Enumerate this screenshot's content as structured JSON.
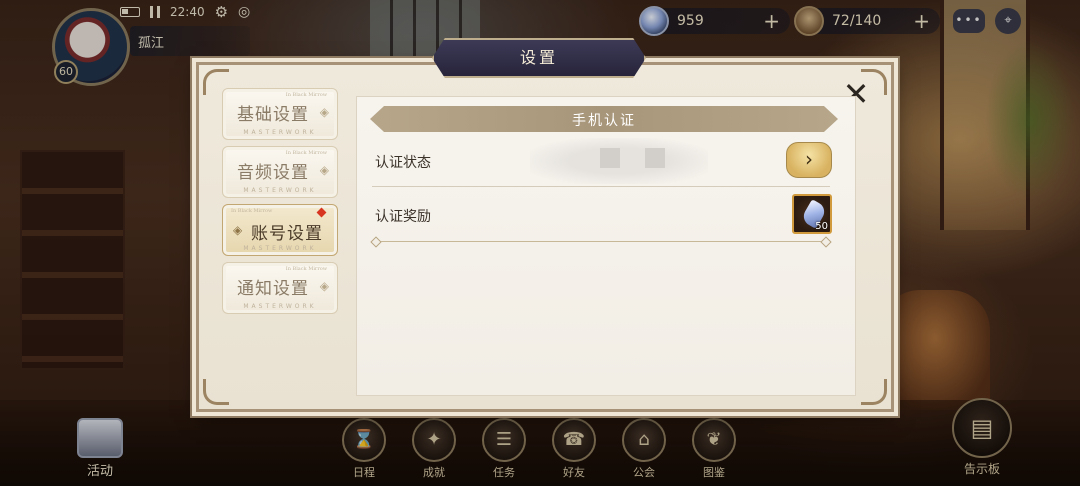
{
  "hud": {
    "time": "22:40",
    "player_name": "孤江",
    "level": "60",
    "gems": "959",
    "stamina": "72/140",
    "plus": "+",
    "chat_dots": "•••"
  },
  "modal": {
    "title": "设置",
    "close_glyph": "✕",
    "tabs": [
      {
        "label": "基础设置",
        "sub": "MASTERWORK",
        "script": "In Black Mirrow",
        "deco": "◈"
      },
      {
        "label": "音频设置",
        "sub": "MASTERWORK",
        "script": "In Black Mirrow",
        "deco": "◈"
      },
      {
        "label": "账号设置",
        "sub": "MASTERWORK",
        "script": "In Black Mirrow",
        "deco": "◈"
      },
      {
        "label": "通知设置",
        "sub": "MASTERWORK",
        "script": "In Black Mirrow",
        "deco": "◈"
      }
    ],
    "section_title": "手机认证",
    "rows": {
      "status_label": "认证状态",
      "reward_label": "认证奖励",
      "go_glyph": "›",
      "reward_count": "50"
    }
  },
  "bottom_nav": {
    "activity": "活动",
    "items": [
      {
        "label": "日程",
        "glyph": "⌛"
      },
      {
        "label": "成就",
        "glyph": "✦"
      },
      {
        "label": "任务",
        "glyph": "☰"
      },
      {
        "label": "好友",
        "glyph": "☎"
      },
      {
        "label": "公会",
        "glyph": "⌂"
      },
      {
        "label": "图鉴",
        "glyph": "❦"
      }
    ],
    "board": "告示板",
    "board_glyph": "▤"
  },
  "colors": {
    "accent_gold": "#d8b260",
    "panel_bg": "#efe9dc",
    "banner_navy": "#27243b",
    "new_badge_red": "#d7351f"
  }
}
